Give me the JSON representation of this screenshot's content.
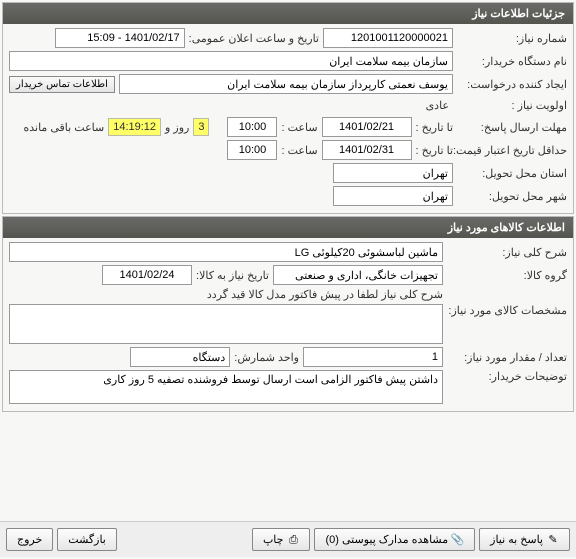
{
  "panel1": {
    "title": "جزئیات اطلاعات نیاز",
    "need_number_lbl": "شماره نیاز:",
    "need_number": "1201001120000021",
    "announce_lbl": "تاریخ و ساعت اعلان عمومی:",
    "announce_val": "1401/02/17 - 15:09",
    "buyer_lbl": "نام دستگاه خریدار:",
    "buyer_val": "سازمان بیمه سلامت ایران",
    "requester_lbl": "ایجاد کننده درخواست:",
    "requester_val": "یوسف نعمتی کارپرداز سازمان بیمه سلامت ایران",
    "contact_btn": "اطلاعات تماس خریدار",
    "priority_lbl": "اولویت نیاز :",
    "priority_val": "عادی",
    "deadline_lbl": "مهلت ارسال پاسخ:",
    "to_date_lbl": "تا تاریخ :",
    "deadline_date": "1401/02/21",
    "time_lbl": "ساعت :",
    "deadline_time": "10:00",
    "days_val": "3",
    "days_txt": "روز و",
    "hms_val": "14:19:12",
    "remain_txt": "ساعت باقی مانده",
    "valid_lbl": "حداقل تاریخ اعتبار قیمت:",
    "valid_date": "1401/02/31",
    "valid_time": "10:00",
    "deliver_prov_lbl": "استان محل تحویل:",
    "deliver_prov_val": "تهران",
    "deliver_city_lbl": "شهر محل تحویل:",
    "deliver_city_val": "تهران"
  },
  "panel2": {
    "title": "اطلاعات کالاهای مورد نیاز",
    "main_desc_lbl": "شرح کلی نیاز:",
    "main_desc_val": "ماشین لباسشوئی 20کیلوئی LG",
    "group_lbl": "گروه کالا:",
    "group_val": "تجهیزات خانگی، اداری و صنعتی",
    "need_date_lbl": "تاریخ نیاز به کالا:",
    "need_date_val": "1401/02/24",
    "note_line": "شرح کلی نیاز لطفا در پیش فاکتور مدل   کالا قید گردد",
    "spec_lbl": "مشخصات کالای مورد نیاز:",
    "spec_val": "",
    "qty_lbl": "تعداد / مقدار مورد نیاز:",
    "qty_val": "1",
    "unit_lbl": "واحد شمارش:",
    "unit_val": "دستگاه",
    "buyer_note_lbl": "توضیحات خریدار:",
    "buyer_note_val": "داشتن پیش فاکتور الزامی است ارسال توسط فروشنده تصفیه 5 روز کاری"
  },
  "footer": {
    "reply": "پاسخ به نیاز",
    "attach": "مشاهده مدارک پیوستی (0)",
    "print": "چاپ",
    "back": "بازگشت",
    "exit": "خروج"
  }
}
